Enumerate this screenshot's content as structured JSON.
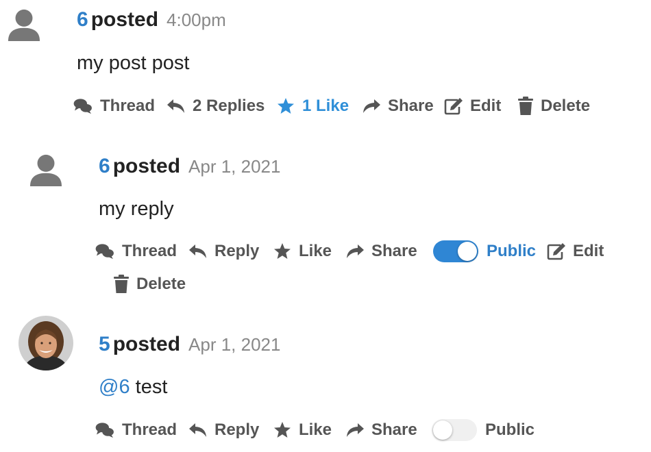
{
  "colors": {
    "author": "#2f7fc8",
    "liked": "#2f8fd8",
    "action": "#555555",
    "timestamp": "#888888",
    "toggle_on": "#2f86d4"
  },
  "posts": [
    {
      "author": "6",
      "posted_label": "posted",
      "time": "4:00pm",
      "body": "my post post",
      "avatar": "default-user-icon",
      "actions": {
        "thread": "Thread",
        "replies": "2 Replies",
        "like": "1 Like",
        "share": "Share",
        "edit": "Edit",
        "delete": "Delete"
      }
    },
    {
      "author": "6",
      "posted_label": "posted",
      "time": "Apr 1, 2021",
      "body": "my reply",
      "avatar": "default-user-icon",
      "actions": {
        "thread": "Thread",
        "reply": "Reply",
        "like": "Like",
        "share": "Share",
        "public": "Public",
        "public_enabled": true,
        "edit": "Edit",
        "delete": "Delete"
      }
    },
    {
      "author": "5",
      "posted_label": "posted",
      "time": "Apr 1, 2021",
      "body_mention": "@6",
      "body_text": "test",
      "avatar": "user-photo",
      "actions": {
        "thread": "Thread",
        "reply": "Reply",
        "like": "Like",
        "share": "Share",
        "public": "Public",
        "public_enabled": false
      }
    }
  ]
}
